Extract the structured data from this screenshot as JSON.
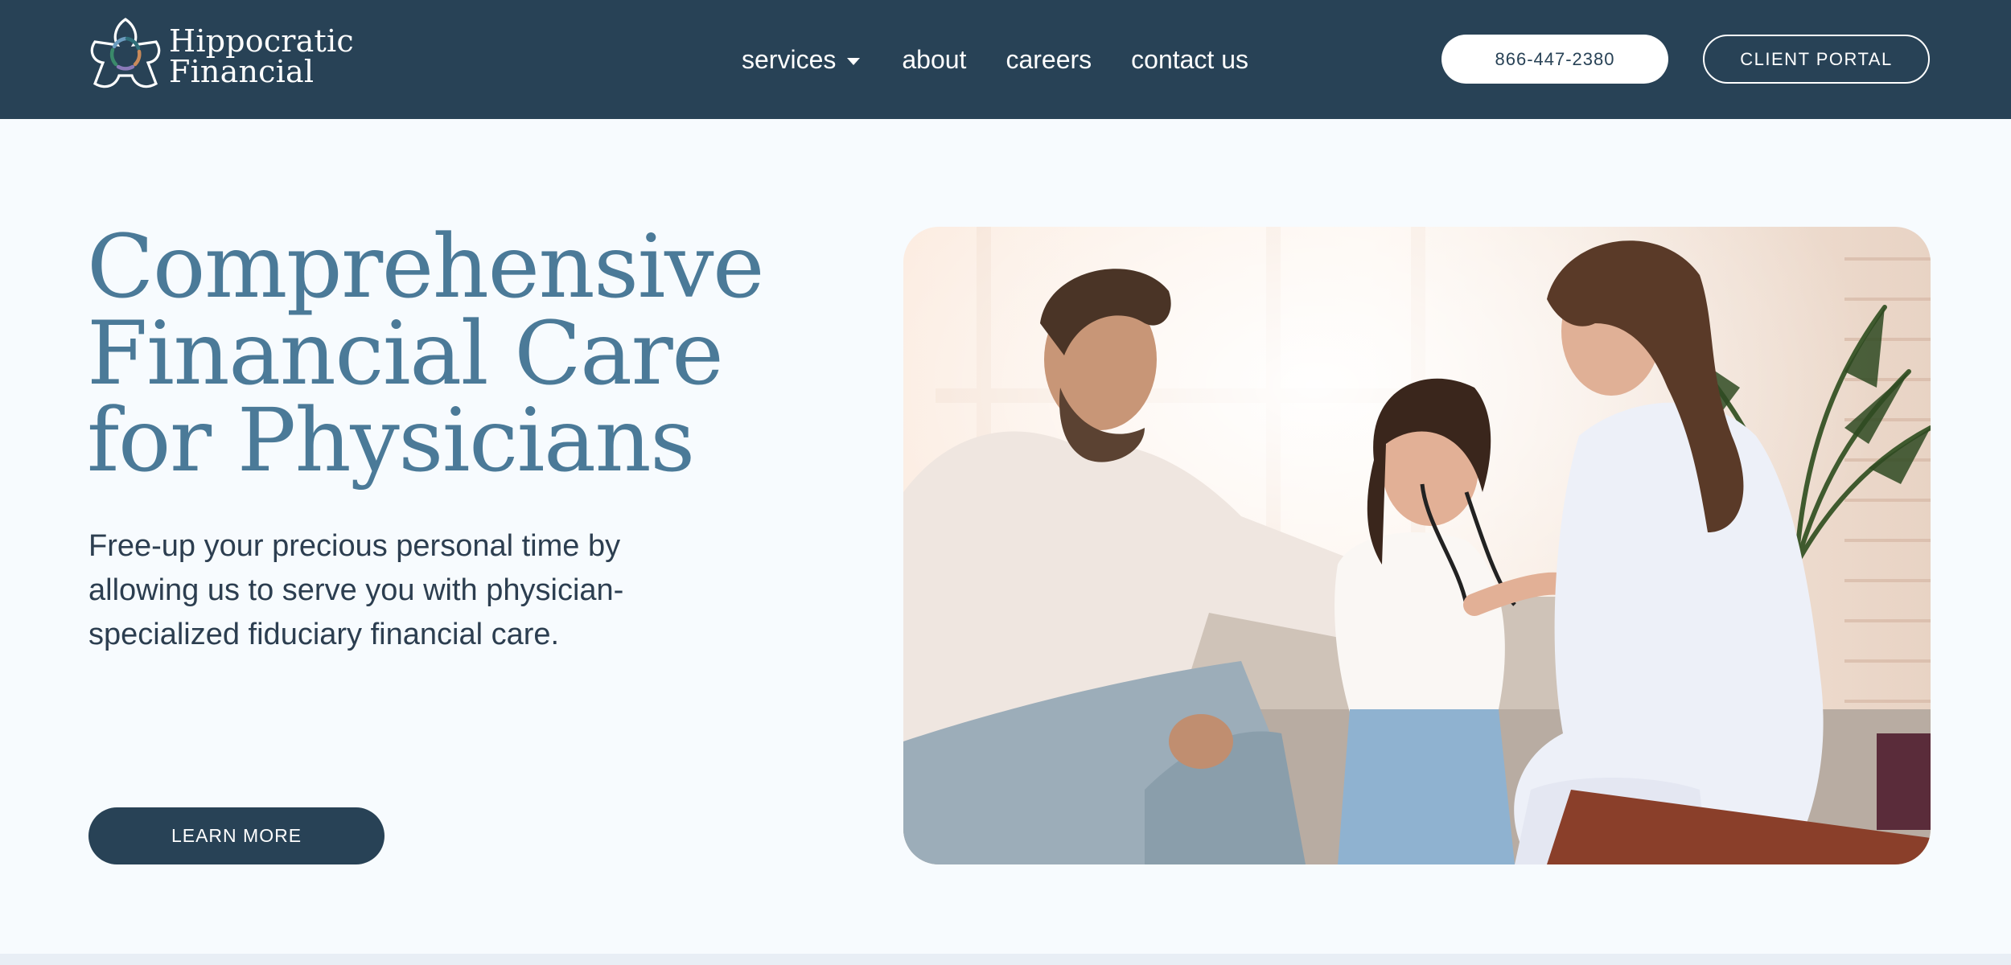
{
  "brand": {
    "line1": "Hippocratic",
    "line2": "Financial",
    "logo_icon": "five-petal-flower-icon",
    "color_primary": "#284256",
    "color_accent": "#4b7a98"
  },
  "nav": {
    "services": "services",
    "about": "about",
    "careers": "careers",
    "contact": "contact us"
  },
  "header": {
    "phone": "866-447-2380",
    "portal": "CLIENT PORTAL"
  },
  "hero": {
    "title_line1": "Comprehensive",
    "title_line2": "Financial Care",
    "title_line3": "for Physicians",
    "subtitle_line1": "Free-up your precious personal time by",
    "subtitle_line2": "allowing us to serve you with physician-",
    "subtitle_line3": "specialized fiduciary financial care.",
    "cta": "LEARN MORE",
    "image_subject": "doctor-with-father-and-daughter-photo"
  }
}
